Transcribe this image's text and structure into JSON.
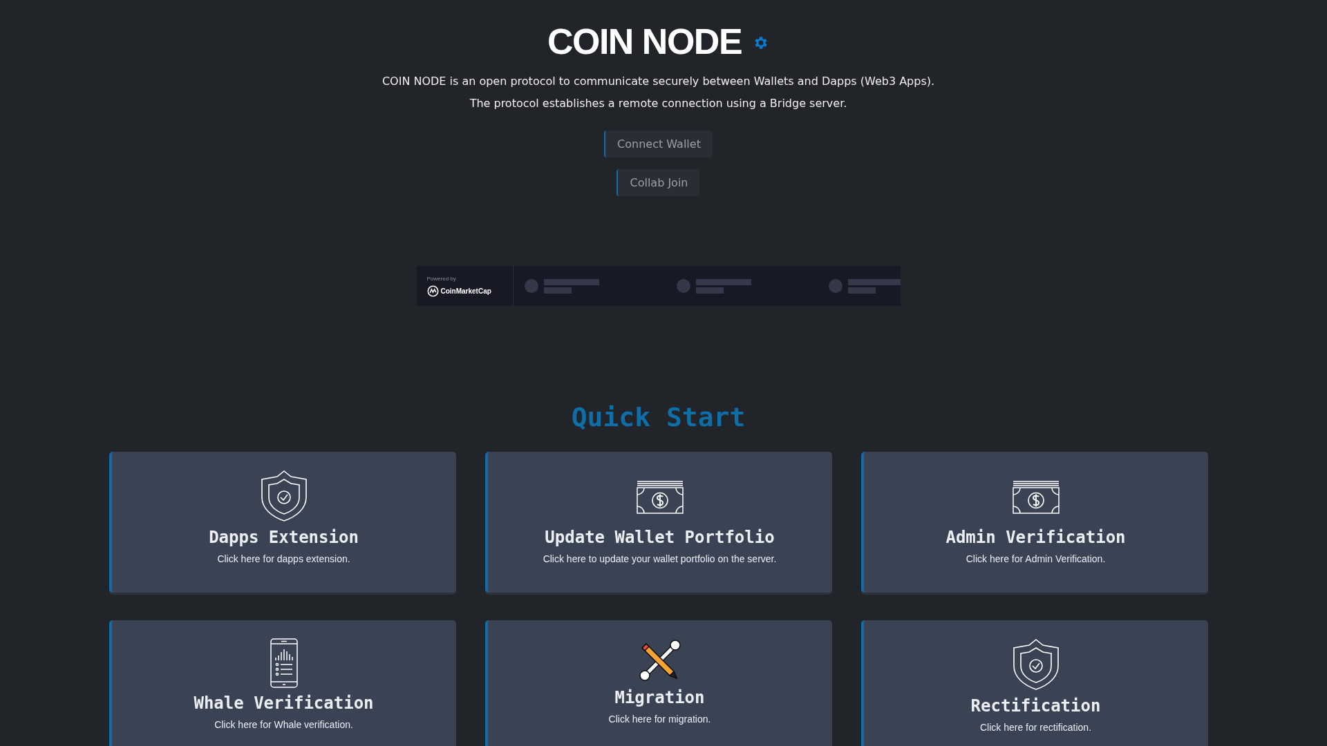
{
  "header": {
    "title": "COIN NODE",
    "description": [
      "COIN NODE is an open protocol to communicate securely between Wallets and Dapps (Web3 Apps).",
      "The protocol establishes a remote connection using a Bridge server."
    ],
    "buttons": [
      "Connect Wallet",
      "Collab Join"
    ]
  },
  "widget": {
    "powered_by": "Powered by",
    "brand": "CoinMarketCap"
  },
  "quick_start": {
    "heading": "Quick Start",
    "cards": [
      {
        "kind": "shield",
        "title": "Dapps Extension",
        "description": "Click here for dapps extension."
      },
      {
        "kind": "bill",
        "title": "Update Wallet Portfolio",
        "description": "Click here to update your wallet portfolio on the server."
      },
      {
        "kind": "bill",
        "title": "Admin Verification",
        "description": "Click here for Admin Verification."
      },
      {
        "kind": "phone",
        "title": "Whale Verification",
        "description": "Click here for Whale verification."
      },
      {
        "kind": "tools",
        "title": "Migration",
        "description": "Click here for migration."
      },
      {
        "kind": "shield",
        "title": "Rectification",
        "description": "Click here for rectification."
      }
    ]
  }
}
